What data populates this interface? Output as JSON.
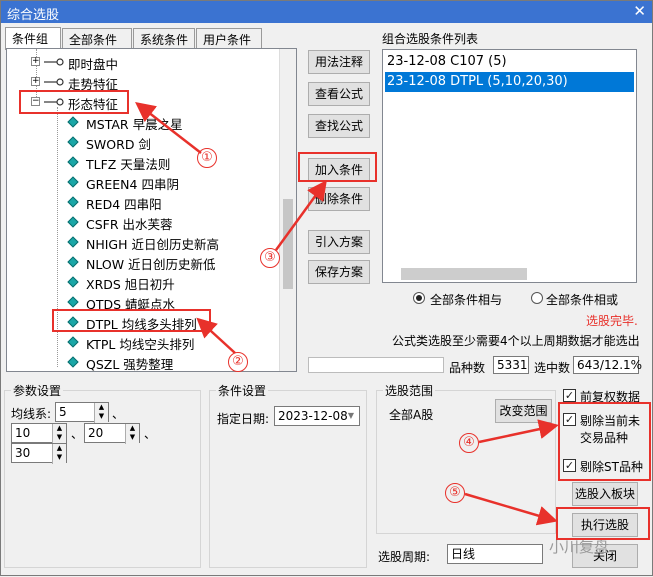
{
  "window": {
    "title": "综合选股",
    "close": "✕"
  },
  "tabs": [
    "条件组",
    "全部条件",
    "系统条件",
    "用户条件"
  ],
  "tree": {
    "groups": [
      {
        "label": "即时盘中",
        "expander": "+"
      },
      {
        "label": "走势特征",
        "expander": "+"
      },
      {
        "label": "形态特征",
        "expander": "−"
      }
    ],
    "items": [
      "MSTAR 早晨之星",
      "SWORD 剑",
      "TLFZ 天量法则",
      "GREEN4 四串阴",
      "RED4 四串阳",
      "CSFR 出水芙蓉",
      "NHIGH 近日创历史新高",
      "NLOW 近日创历史新低",
      "XRDS 旭日初升",
      "QTDS 蜻蜓点水",
      "DTPL 均线多头排列",
      "KTPL 均线空头排列",
      "QSZL 强势整理"
    ]
  },
  "buttons": {
    "usage": "用法注释",
    "view_formula": "查看公式",
    "find_formula": "查找公式",
    "add_condition": "加入条件",
    "delete_condition": "删除条件",
    "import_plan": "引入方案",
    "save_plan": "保存方案",
    "change_range": "改变范围",
    "to_board": "选股入板块",
    "execute": "执行选股",
    "close": "关闭"
  },
  "conditions": {
    "title": "组合选股条件列表",
    "items": [
      "23-12-08 C107 (5)",
      "23-12-08 DTPL (5,10,20,30)"
    ],
    "selected_index": 1,
    "radio_and": "全部条件相与",
    "radio_or": "全部条件相或",
    "radio_and_selected": true
  },
  "status": {
    "done": "选股完毕.",
    "note": "公式类选股至少需要4个以上周期数据才能选出",
    "progress": 0,
    "count_label": "品种数",
    "count_value": "5331",
    "selected_label": "选中数",
    "selected_value": "643/12.1%"
  },
  "params": {
    "legend": "参数设置",
    "ma_label": "均线系:",
    "values": [
      "5",
      "10",
      "20",
      "30"
    ],
    "sep": "、"
  },
  "cond_settings": {
    "legend": "条件设置",
    "date_label": "指定日期:",
    "date_value": "2023-12-08"
  },
  "range": {
    "legend": "选股范围",
    "value": "全部A股"
  },
  "options": {
    "pre_adjust": "前复权数据",
    "exclude_untraded": "剔除当前未交易品种",
    "exclude_untraded_line1": "剔除当前未",
    "exclude_untraded_line2": "交易品种",
    "exclude_st": "剔除ST品种",
    "checked": [
      true,
      true,
      true
    ],
    "check_mark": "✓"
  },
  "period": {
    "label": "选股周期:",
    "value": "日线"
  },
  "watermark": "小川复盘",
  "annotations": {
    "marks": [
      "①",
      "②",
      "③",
      "④",
      "⑤"
    ],
    "color": "#e8312b"
  }
}
